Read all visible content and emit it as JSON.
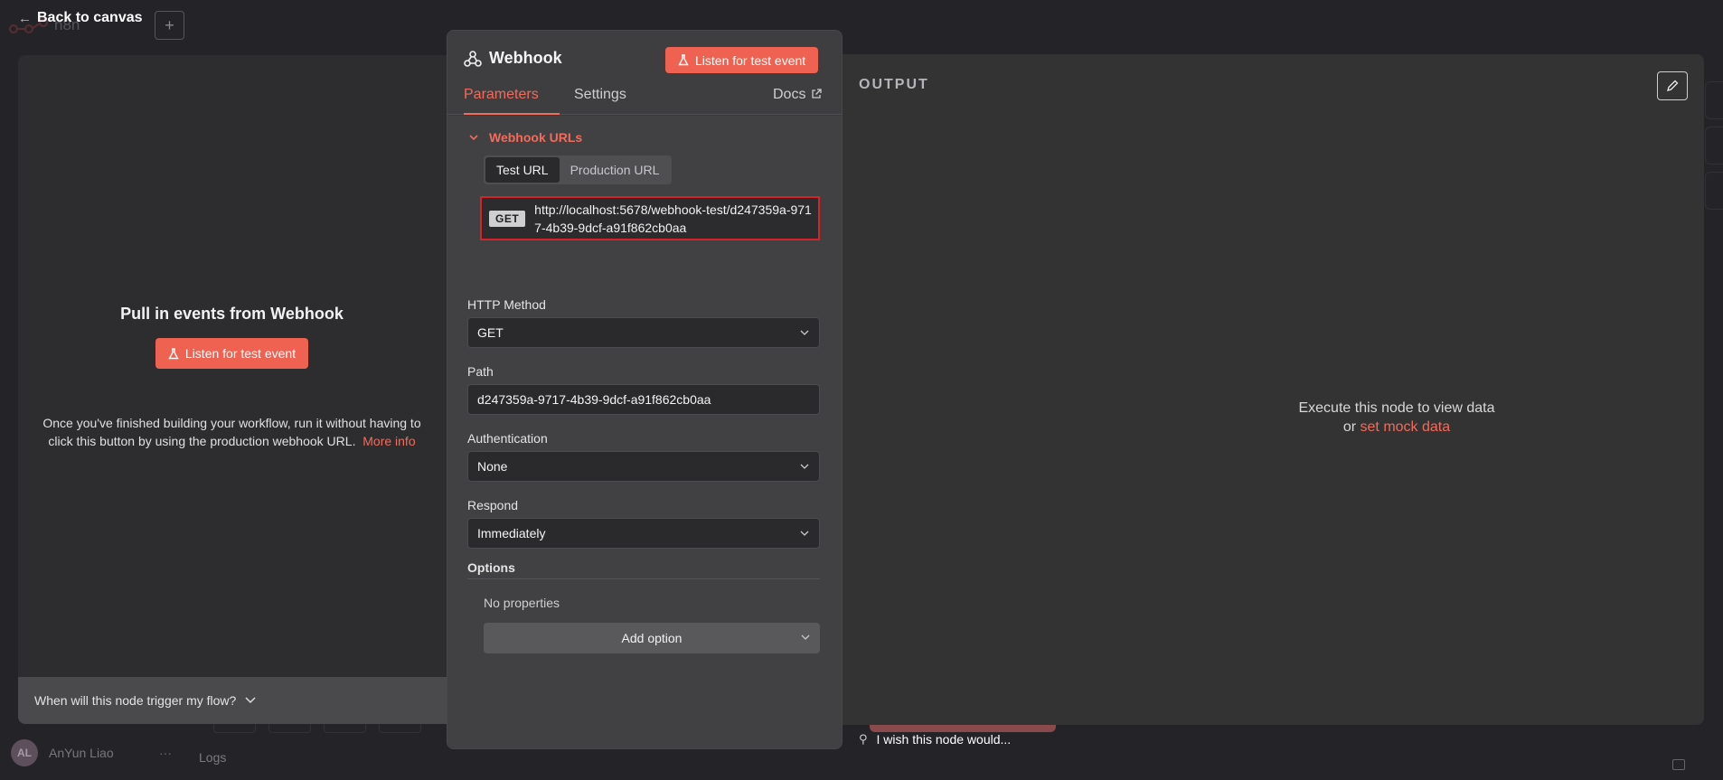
{
  "app": {
    "back_label": "Back to canvas",
    "plus_label": "+",
    "logo_text": "n8n",
    "user": {
      "initials": "AL",
      "name": "AnYun Liao",
      "more": "···"
    },
    "logs_label": "Logs",
    "wish_text": "I wish this node would..."
  },
  "input_panel": {
    "title": "Pull in events from Webhook",
    "listen_label": "Listen for test event",
    "note_text": "Once you've finished building your workflow, run it without having to click this button by using the production webhook URL.",
    "more_info_link": "More info",
    "trigger_question": "When will this node trigger my flow?"
  },
  "node": {
    "title": "Webhook",
    "icon": "webhook-icon",
    "listen_label": "Listen for test event",
    "tabs": [
      {
        "label": "Parameters",
        "active": true
      },
      {
        "label": "Settings",
        "active": false
      }
    ],
    "docs_label": "Docs",
    "webhook_urls": {
      "section_label": "Webhook URLs",
      "toggle": [
        {
          "label": "Test URL",
          "active": true
        },
        {
          "label": "Production URL",
          "active": false
        }
      ],
      "method": "GET",
      "url": "http://localhost:5678/webhook-test/d247359a-9717-4b39-9dcf-a91f862cb0aa"
    },
    "fields": {
      "http_method": {
        "label": "HTTP Method",
        "value": "GET"
      },
      "path": {
        "label": "Path",
        "value": "d247359a-9717-4b39-9dcf-a91f862cb0aa"
      },
      "authentication": {
        "label": "Authentication",
        "value": "None"
      },
      "respond": {
        "label": "Respond",
        "value": "Immediately"
      }
    },
    "options": {
      "label": "Options",
      "empty_text": "No properties",
      "add_label": "Add option"
    }
  },
  "output_panel": {
    "title": "OUTPUT",
    "message_line1": "Execute this node to view data",
    "message_or": "or",
    "mock_link": "set mock data"
  },
  "colors": {
    "accent": "#ef6150",
    "link": "#f26b5b",
    "highlight_border": "#d8222b"
  }
}
